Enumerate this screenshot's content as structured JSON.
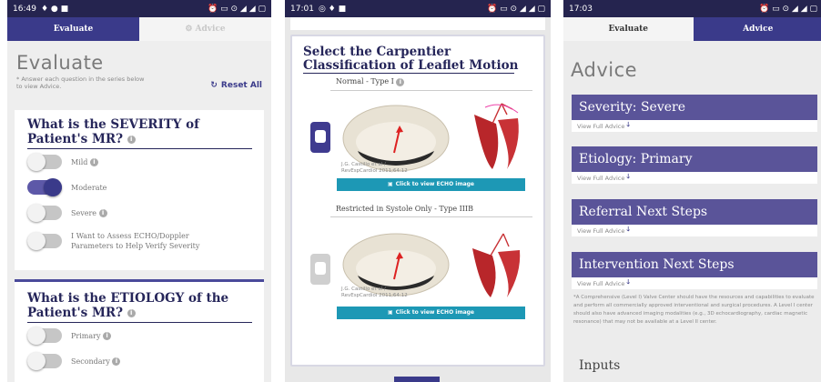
{
  "screens": [
    {
      "time": "16:49",
      "tabs": [
        {
          "label": "Evaluate",
          "active": true
        },
        {
          "label": "⚙ Advice",
          "active": false
        }
      ],
      "title": "Evaluate",
      "instructions": "* Answer each question in the series below to view Advice.",
      "reset_label": "Reset All",
      "questions": [
        {
          "title": "What is the SEVERITY of Patient's MR?",
          "options": [
            {
              "label": "Mild",
              "on": false,
              "info": true
            },
            {
              "label": "Moderate",
              "on": true,
              "info": false
            },
            {
              "label": "Severe",
              "on": false,
              "info": true
            },
            {
              "label": "I Want to Assess ECHO/Doppler Parameters to Help Verify Severity",
              "on": false,
              "info": false
            }
          ]
        },
        {
          "title": "What is the ETIOLOGY of the Patient's MR?",
          "options": [
            {
              "label": "Primary",
              "on": false,
              "info": true
            },
            {
              "label": "Secondary",
              "on": false,
              "info": true
            }
          ]
        }
      ]
    },
    {
      "time": "17:01",
      "title": "Select the Carpentier Classification of Leaflet Motion",
      "types": [
        {
          "label": "Normal - Type I",
          "selected": true,
          "credit": "J.G. Castillo et al / RevEspCardiol 2011;64:12",
          "button": "Click to view ECHO image"
        },
        {
          "label": "Restricted in Systole Only - Type IIIB",
          "selected": false,
          "credit": "J.G. Castillo et al / RevEspCardiol 2011;64:12",
          "button": "Click to view ECHO image"
        }
      ]
    },
    {
      "time": "17:03",
      "tabs": [
        {
          "label": "Evaluate",
          "active": false
        },
        {
          "label": "Advice",
          "active": true
        }
      ],
      "title": "Advice",
      "advice": [
        {
          "heading": "Severity: Severe",
          "link": "View Full Advice"
        },
        {
          "heading": "Etiology: Primary",
          "link": "View Full Advice"
        },
        {
          "heading": "Referral Next Steps",
          "link": "View Full Advice"
        },
        {
          "heading": "Intervention Next Steps",
          "link": "View Full Advice"
        }
      ],
      "footnote": "*A Comprehensive (Level I) Valve Center should have the resources and capabilities to evaluate and perform all commercially approved interventional and surgical procedures. A Level I center should also have advanced imaging modalities (e.g., 3D echocardiography, cardiac magnetic resonance) that may not be available at a Level II center.",
      "inputs_label": "Inputs"
    }
  ],
  "status_icons": "⏰ ▭ ⊙ ◢ ◢ ▢",
  "colors": {
    "primary": "#3a3a8a",
    "heading": "#26265a",
    "advice": "#5a5499",
    "echo": "#1d98b5"
  }
}
